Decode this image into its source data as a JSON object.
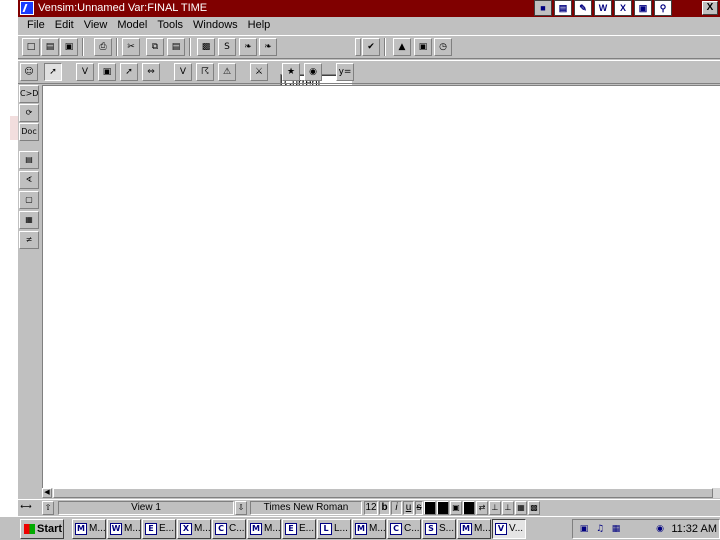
{
  "window": {
    "title": "Vensim:Unnamed Var:FINAL TIME",
    "close_label": "X",
    "tray_icons": [
      "doc-icon",
      "notepad-icon",
      "folder-icon",
      "word-icon",
      "excel-icon",
      "display-icon",
      "search-icon"
    ]
  },
  "menu": {
    "items": [
      "File",
      "Edit",
      "View",
      "Model",
      "Tools",
      "Windows",
      "Help"
    ]
  },
  "toolbar_main": {
    "run_name": "Current"
  },
  "left_tools": {
    "doc_label": "Doc",
    "causes_label": "C>D"
  },
  "statusbar": {
    "view_label": "View 1",
    "font_name": "Times New Roman",
    "font_size": "12",
    "bold_label": "b",
    "italic_label": "i",
    "underline_label": "u",
    "strike_label": "s"
  },
  "taskbar": {
    "start_label": "Start",
    "tasks": [
      {
        "label": "M...",
        "icon": "M"
      },
      {
        "label": "M...",
        "icon": "W"
      },
      {
        "label": "E...",
        "icon": "E"
      },
      {
        "label": "M...",
        "icon": "X"
      },
      {
        "label": "C...",
        "icon": "C"
      },
      {
        "label": "M...",
        "icon": "M"
      },
      {
        "label": "E...",
        "icon": "E"
      },
      {
        "label": "L...",
        "icon": "L"
      },
      {
        "label": "M...",
        "icon": "M"
      },
      {
        "label": "C...",
        "icon": "C"
      },
      {
        "label": "S...",
        "icon": "S"
      },
      {
        "label": "M...",
        "icon": "M"
      },
      {
        "label": "V...",
        "icon": "V"
      }
    ],
    "clock": "11:32 AM"
  },
  "colors": {
    "title_bar": "#800000",
    "chrome": "#c0c0c0",
    "workspace": "#ffffff"
  }
}
